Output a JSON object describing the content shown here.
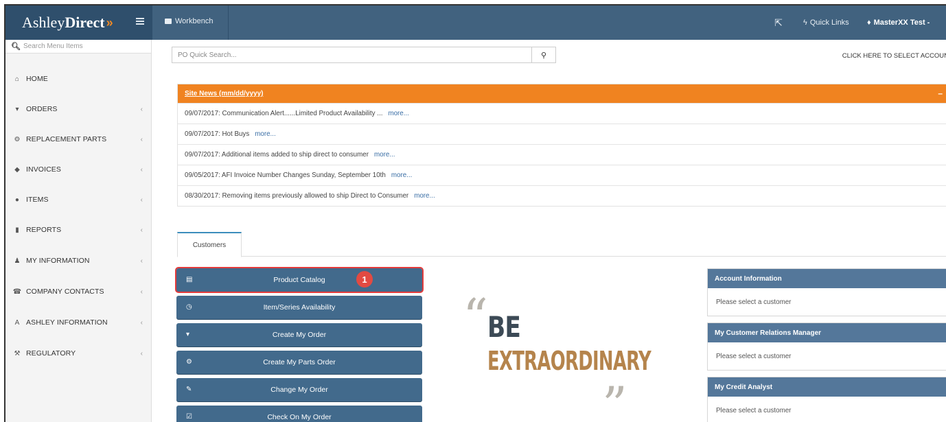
{
  "brand": {
    "name_part1": "Ashley",
    "name_part2": "Direct",
    "chevrons": "»"
  },
  "topbar": {
    "workbench_label": "Workbench",
    "quick_links_label": "Quick Links",
    "user_label": "MasterXX Test -"
  },
  "sidebar": {
    "search_placeholder": "Search Menu Items",
    "items": [
      {
        "label": "HOME",
        "icon": "home-icon",
        "glyph": "⌂",
        "has_arrow": false
      },
      {
        "label": "ORDERS",
        "icon": "cart-icon",
        "glyph": "▾",
        "has_arrow": true
      },
      {
        "label": "REPLACEMENT PARTS",
        "icon": "cogs-icon",
        "glyph": "⚙",
        "has_arrow": true
      },
      {
        "label": "INVOICES",
        "icon": "tag-icon",
        "glyph": "◆",
        "has_arrow": true
      },
      {
        "label": "ITEMS",
        "icon": "info-circle-icon",
        "glyph": "●",
        "has_arrow": true
      },
      {
        "label": "REPORTS",
        "icon": "file-icon",
        "glyph": "▮",
        "has_arrow": true
      },
      {
        "label": "MY INFORMATION",
        "icon": "user-icon",
        "glyph": "♟",
        "has_arrow": true
      },
      {
        "label": "COMPANY CONTACTS",
        "icon": "phone-icon",
        "glyph": "☎",
        "has_arrow": true
      },
      {
        "label": "ASHLEY INFORMATION",
        "icon": "ashley-a-icon",
        "glyph": "A",
        "has_arrow": true
      },
      {
        "label": "REGULATORY",
        "icon": "gavel-icon",
        "glyph": "⚒",
        "has_arrow": true
      }
    ],
    "arrow_glyph": "‹"
  },
  "po_search": {
    "placeholder": "PO Quick Search..."
  },
  "select_account_label": "CLICK HERE TO SELECT ACCOUN",
  "site_news": {
    "title": "Site News",
    "subtitle": "(mm/dd/yyyy)",
    "collapse_glyph": "–",
    "items": [
      {
        "text": "09/07/2017: Communication Alert......Limited Product Availability ...",
        "more": "more..."
      },
      {
        "text": "09/07/2017: Hot Buys",
        "more": "more..."
      },
      {
        "text": "09/07/2017: Additional items added to ship direct to consumer",
        "more": "more..."
      },
      {
        "text": "09/05/2017: AFI Invoice Number Changes Sunday, September 10th",
        "more": "more..."
      },
      {
        "text": "08/30/2017: Removing items previously allowed to ship Direct to Consumer",
        "more": "more..."
      }
    ]
  },
  "tabs": {
    "customers": "Customers"
  },
  "customer_buttons": [
    {
      "label": "Product Catalog",
      "icon": "file-icon",
      "glyph": "▤"
    },
    {
      "label": "Item/Series Availability",
      "icon": "clock-icon",
      "glyph": "◷"
    },
    {
      "label": "Create My Order",
      "icon": "cart-icon",
      "glyph": "▾"
    },
    {
      "label": "Create My Parts Order",
      "icon": "cogs-icon",
      "glyph": "⚙"
    },
    {
      "label": "Change My Order",
      "icon": "edit-icon",
      "glyph": "✎"
    },
    {
      "label": "Check On My Order",
      "icon": "check-square-icon",
      "glyph": "☑"
    }
  ],
  "step_badge": "1",
  "quote": {
    "open": "“",
    "close": "”",
    "line1": "BE",
    "line2": "EXTRAORDINARY"
  },
  "panels": [
    {
      "title": "Account Information",
      "body": "Please select a customer"
    },
    {
      "title": "My Customer Relations Manager",
      "body": "Please select a customer"
    },
    {
      "title": "My Credit Analyst",
      "body": "Please select a customer"
    }
  ],
  "colors": {
    "brand_blue": "#41627f",
    "accent_orange": "#f08320",
    "button_blue": "#426a8c",
    "highlight_red": "#e33b3b"
  }
}
